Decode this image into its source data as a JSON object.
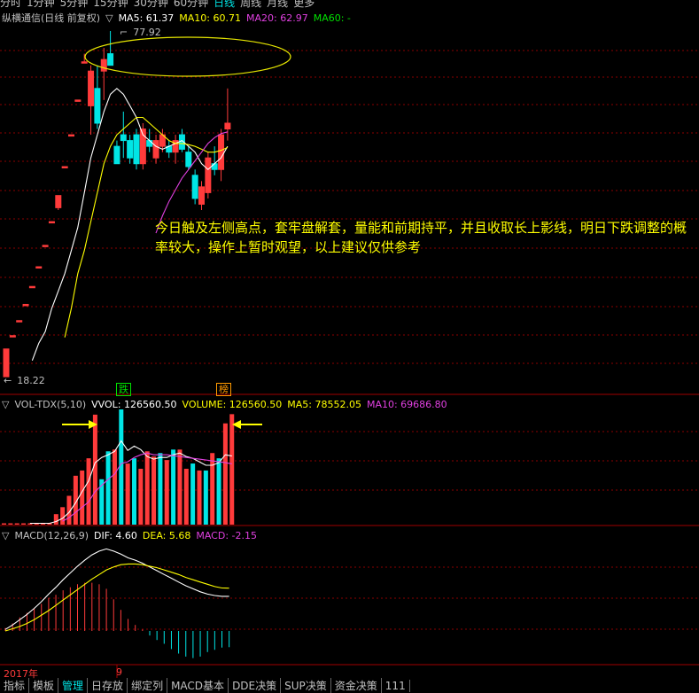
{
  "period_tabs": [
    "分时",
    "1分钟",
    "5分钟",
    "15分钟",
    "30分钟",
    "60分钟",
    "日线",
    "周线",
    "月线",
    "更多"
  ],
  "active_period": "日线",
  "price_panel": {
    "stock_title": "纵横通信(日线 前复权)",
    "marker": "▽",
    "ma5": "MA5: 61.37",
    "ma10": "MA10: 60.71",
    "ma20": "MA20: 62.97",
    "ma60": "MA60: -",
    "high_label": "77.92",
    "low_label": "18.22",
    "annotation": "今日触及左侧高点，套牢盘解套，量能和前期持平，并且收取长上影线，明日下跌调整的概率较大，操作上暂时观望，以上建议仅供参考",
    "badge_drop": "跌",
    "badge_rank": "榜"
  },
  "volume_panel": {
    "marker": "▽",
    "name": "VOL-TDX(5,10)",
    "vvol": "VVOL: 126560.50",
    "volume": "VOLUME: 126560.50",
    "ma5": "MA5: 78552.05",
    "ma10": "MA10: 69686.80"
  },
  "macd_panel": {
    "marker": "▽",
    "name": "MACD(12,26,9)",
    "dif": "DIF: 4.60",
    "dea": "DEA: 5.68",
    "macd": "MACD: -2.15"
  },
  "axis": {
    "year_label": "2017年",
    "month_label": "9"
  },
  "bottom_tabs": [
    "指标",
    "模板",
    "管理",
    "日存放",
    "绑定列",
    "MACD基本",
    "DDE决策",
    "SUP决策",
    "资金决策",
    "111"
  ],
  "active_bottom_tab": "管理",
  "colors": {
    "up": "#ff3b3b",
    "down": "#00e5e5",
    "ma5": "#ffffff",
    "ma10": "#ffff00",
    "ma20": "#e040e0",
    "ma60": "#00e000",
    "grid": "#8b0000",
    "ellipse": "#e6e600"
  },
  "chart_data": {
    "type": "candlestick",
    "price_range": [
      18.22,
      77.92
    ],
    "candles": [
      {
        "o": 18.2,
        "h": 23.0,
        "l": 18.2,
        "c": 23.0
      },
      {
        "o": 25.2,
        "h": 25.3,
        "l": 25.2,
        "c": 25.3
      },
      {
        "o": 27.8,
        "h": 27.9,
        "l": 27.8,
        "c": 27.9
      },
      {
        "o": 30.6,
        "h": 30.7,
        "l": 30.6,
        "c": 30.7
      },
      {
        "o": 33.7,
        "h": 33.8,
        "l": 33.7,
        "c": 33.8
      },
      {
        "o": 37.1,
        "h": 37.2,
        "l": 37.1,
        "c": 37.2
      },
      {
        "o": 40.8,
        "h": 40.9,
        "l": 40.8,
        "c": 40.9
      },
      {
        "o": 44.9,
        "h": 45.0,
        "l": 44.9,
        "c": 45.0
      },
      {
        "o": 47.4,
        "h": 49.5,
        "l": 47.0,
        "c": 49.5
      },
      {
        "o": 54.4,
        "h": 54.5,
        "l": 54.4,
        "c": 54.5
      },
      {
        "o": 59.9,
        "h": 60.0,
        "l": 59.9,
        "c": 60.0
      },
      {
        "o": 65.9,
        "h": 66.0,
        "l": 65.9,
        "c": 66.0
      },
      {
        "o": 72.5,
        "h": 74.0,
        "l": 72.5,
        "c": 72.6
      },
      {
        "o": 65.0,
        "h": 72.0,
        "l": 60.0,
        "c": 71.0
      },
      {
        "o": 68.0,
        "h": 72.0,
        "l": 61.0,
        "c": 62.0
      },
      {
        "o": 71.0,
        "h": 75.0,
        "l": 66.0,
        "c": 73.0
      },
      {
        "o": 74.0,
        "h": 77.92,
        "l": 72.0,
        "c": 72.0
      },
      {
        "o": 58.0,
        "h": 59.0,
        "l": 55.0,
        "c": 55.0
      },
      {
        "o": 60.0,
        "h": 64.0,
        "l": 56.0,
        "c": 59.0
      },
      {
        "o": 59.0,
        "h": 60.0,
        "l": 55.0,
        "c": 56.0
      },
      {
        "o": 60.0,
        "h": 61.0,
        "l": 54.0,
        "c": 55.0
      },
      {
        "o": 55.0,
        "h": 62.0,
        "l": 54.0,
        "c": 61.0
      },
      {
        "o": 59.0,
        "h": 61.0,
        "l": 57.0,
        "c": 58.0
      },
      {
        "o": 56.0,
        "h": 60.0,
        "l": 55.0,
        "c": 59.0
      },
      {
        "o": 58.0,
        "h": 61.0,
        "l": 57.0,
        "c": 60.0
      },
      {
        "o": 58.0,
        "h": 59.0,
        "l": 56.0,
        "c": 57.0
      },
      {
        "o": 57.0,
        "h": 60.0,
        "l": 55.0,
        "c": 59.0
      },
      {
        "o": 60.0,
        "h": 61.0,
        "l": 57.0,
        "c": 57.5
      },
      {
        "o": 57.0,
        "h": 58.0,
        "l": 54.0,
        "c": 54.5
      },
      {
        "o": 53.0,
        "h": 54.0,
        "l": 48.0,
        "c": 49.0
      },
      {
        "o": 48.0,
        "h": 52.0,
        "l": 47.0,
        "c": 51.0
      },
      {
        "o": 50.0,
        "h": 57.0,
        "l": 49.0,
        "c": 56.0
      },
      {
        "o": 55.0,
        "h": 58.0,
        "l": 53.0,
        "c": 54.0
      },
      {
        "o": 54.0,
        "h": 61.0,
        "l": 52.0,
        "c": 60.0
      },
      {
        "o": 61.0,
        "h": 68.0,
        "l": 59.0,
        "c": 62.0
      }
    ],
    "ma5": [
      null,
      null,
      null,
      null,
      21,
      24,
      26,
      30,
      33,
      36,
      40,
      44,
      50,
      56,
      60,
      64,
      67,
      68,
      67,
      65,
      63,
      60,
      59,
      58,
      57.5,
      58,
      58.5,
      59,
      58,
      57,
      55,
      54,
      55,
      56,
      58
    ],
    "ma10": [
      null,
      null,
      null,
      null,
      null,
      null,
      null,
      null,
      null,
      25,
      30,
      36,
      40,
      45,
      50,
      55,
      58,
      60,
      61,
      62,
      63,
      63,
      62,
      61,
      60,
      59,
      58.5,
      58.5,
      58.3,
      58,
      57.5,
      57,
      57,
      57.3,
      57.8
    ],
    "ma20": [
      null,
      null,
      null,
      null,
      null,
      null,
      null,
      null,
      null,
      null,
      null,
      null,
      null,
      null,
      null,
      null,
      null,
      null,
      null,
      null,
      null,
      null,
      null,
      43,
      46,
      48.5,
      50.5,
      52.5,
      54,
      55.5,
      57,
      58.5,
      59.5,
      60.2,
      60.5
    ],
    "volume": {
      "values": [
        1500,
        1500,
        1500,
        1500,
        1500,
        1500,
        1500,
        1500,
        12000,
        20000,
        33000,
        56000,
        62000,
        76000,
        126000,
        52000,
        84000,
        86000,
        132000,
        70000,
        76000,
        64000,
        84000,
        78000,
        82000,
        74000,
        86000,
        86000,
        64000,
        70000,
        62000,
        62000,
        82000,
        76000,
        116000,
        126560
      ],
      "up": [
        1,
        1,
        1,
        1,
        1,
        1,
        1,
        1,
        1,
        1,
        1,
        1,
        1,
        1,
        1,
        0,
        0,
        1,
        0,
        1,
        0,
        1,
        1,
        1,
        0,
        1,
        0,
        1,
        1,
        0,
        1,
        0,
        1,
        0,
        1,
        1
      ],
      "ma5": [
        null,
        null,
        null,
        null,
        1500,
        1500,
        1500,
        1500,
        3600,
        7200,
        14000,
        25000,
        38000,
        50000,
        71000,
        77000,
        80000,
        84000,
        96000,
        85000,
        90000,
        86000,
        78000,
        75000,
        77000,
        77000,
        80000,
        82000,
        78000,
        76000,
        72000,
        68000,
        68000,
        71000,
        80000,
        78552
      ],
      "ma10": [
        null,
        null,
        null,
        null,
        null,
        null,
        null,
        null,
        null,
        4000,
        8000,
        14000,
        20000,
        26000,
        38000,
        45000,
        52000,
        58000,
        70000,
        72000,
        77000,
        80000,
        82000,
        80000,
        80000,
        80000,
        79000,
        78000,
        77000,
        76000,
        75000,
        74000,
        73000,
        72000,
        71000,
        69687
      ]
    },
    "macd": {
      "dif": [
        0.2,
        0.8,
        1.5,
        2.2,
        3.0,
        3.9,
        4.9,
        5.8,
        6.8,
        7.7,
        8.6,
        9.4,
        10.1,
        10.6,
        10.9,
        10.6,
        10.2,
        9.7,
        9.4,
        9.0,
        8.5,
        8.0,
        7.5,
        7.0,
        6.5,
        6.0,
        5.6,
        5.2,
        4.9,
        4.7,
        4.6,
        4.6
      ],
      "dea": [
        0.0,
        0.3,
        0.6,
        1.0,
        1.5,
        2.1,
        2.7,
        3.4,
        4.1,
        4.8,
        5.5,
        6.2,
        6.9,
        7.5,
        8.1,
        8.5,
        8.8,
        8.9,
        8.9,
        8.8,
        8.6,
        8.4,
        8.1,
        7.8,
        7.5,
        7.1,
        6.8,
        6.5,
        6.2,
        5.9,
        5.7,
        5.68
      ],
      "hist": [
        0.4,
        1.0,
        1.8,
        2.4,
        3.0,
        3.6,
        4.4,
        4.8,
        5.4,
        5.8,
        6.2,
        6.4,
        6.4,
        6.2,
        5.6,
        4.2,
        2.8,
        1.6,
        0.8,
        0.2,
        -0.6,
        -1.2,
        -1.7,
        -2.4,
        -3.0,
        -3.4,
        -3.6,
        -3.4,
        -2.8,
        -2.5,
        -2.2,
        -2.15
      ]
    }
  }
}
